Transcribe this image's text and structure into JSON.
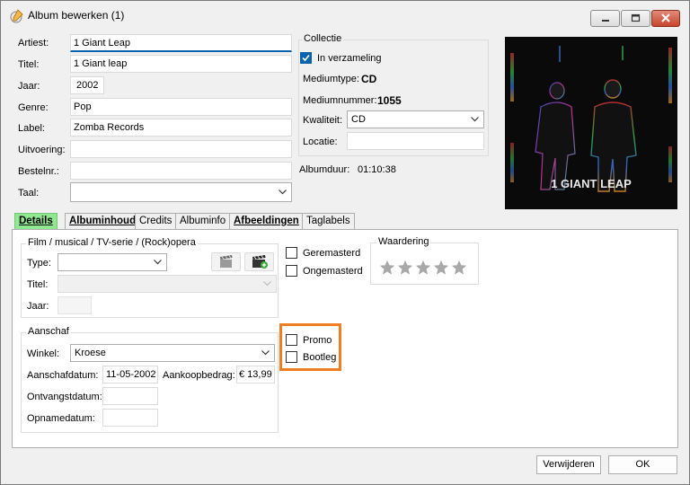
{
  "window": {
    "title": "Album bewerken (1)",
    "icon": "edit-cd-icon"
  },
  "form": {
    "artiest": {
      "label": "Artiest:",
      "value": "1 Giant Leap"
    },
    "titel": {
      "label": "Titel:",
      "value": "1 Giant leap"
    },
    "jaar": {
      "label": "Jaar:",
      "value": "2002"
    },
    "genre": {
      "label": "Genre:",
      "value": "Pop"
    },
    "label": {
      "label": "Label:",
      "value": "Zomba Records"
    },
    "uitvoering": {
      "label": "Uitvoering:",
      "value": ""
    },
    "bestelnr": {
      "label": "Bestelnr.:",
      "value": ""
    },
    "taal": {
      "label": "Taal:",
      "value": ""
    }
  },
  "collectie": {
    "title": "Collectie",
    "in_verzameling": {
      "label": "In verzameling",
      "checked": true
    },
    "mediumtype_label": "Mediumtype:",
    "mediumtype_value": "CD",
    "mediumnummer_label": "Mediumnummer:",
    "mediumnummer_value": "1055",
    "kwaliteit_label": "Kwaliteit:",
    "kwaliteit_value": "CD",
    "locatie_label": "Locatie:",
    "locatie_value": ""
  },
  "albumduur": {
    "label": "Albumduur:",
    "value": "01:10:38"
  },
  "cover": {
    "text": "1 GIANT LEAP"
  },
  "tabs": [
    {
      "label": "Details",
      "active": true,
      "bold": true
    },
    {
      "label": "Albuminhoud",
      "active": false,
      "bold": true
    },
    {
      "label": "Credits",
      "active": false,
      "bold": false
    },
    {
      "label": "Albuminfo",
      "active": false,
      "bold": false
    },
    {
      "label": "Afbeeldingen",
      "active": false,
      "bold": true
    },
    {
      "label": "Taglabels",
      "active": false,
      "bold": false
    }
  ],
  "film": {
    "title": "Film / musical / TV-serie / (Rock)opera",
    "type_label": "Type:",
    "type_value": "",
    "titel_label": "Titel:",
    "titel_value": "",
    "jaar_label": "Jaar:",
    "jaar_value": ""
  },
  "remaster": {
    "geremasterd": {
      "label": "Geremasterd",
      "checked": false
    },
    "ongemasterd": {
      "label": "Ongemasterd",
      "checked": false
    }
  },
  "waardering": {
    "title": "Waardering",
    "stars": 5,
    "rating": 0
  },
  "aanschaf": {
    "title": "Aanschaf",
    "winkel_label": "Winkel:",
    "winkel_value": "Kroese",
    "aanschafdatum_label": "Aanschafdatum:",
    "aanschafdatum_value": "11-05-2002",
    "aankoopbedrag_label": "Aankoopbedrag:",
    "aankoopbedrag_value": "€ 13,99",
    "ontvangstdatum_label": "Ontvangstdatum:",
    "ontvangstdatum_value": "",
    "opnamedatum_label": "Opnamedatum:",
    "opnamedatum_value": ""
  },
  "flags": {
    "promo": {
      "label": "Promo",
      "checked": false
    },
    "bootleg": {
      "label": "Bootleg",
      "checked": false
    }
  },
  "buttons": {
    "delete": "Verwijderen",
    "ok": "OK"
  },
  "colors": {
    "accent": "#0a64ad",
    "active_tab": "#90e890",
    "highlight": "#f07d22",
    "star": "#a8a8a8"
  }
}
